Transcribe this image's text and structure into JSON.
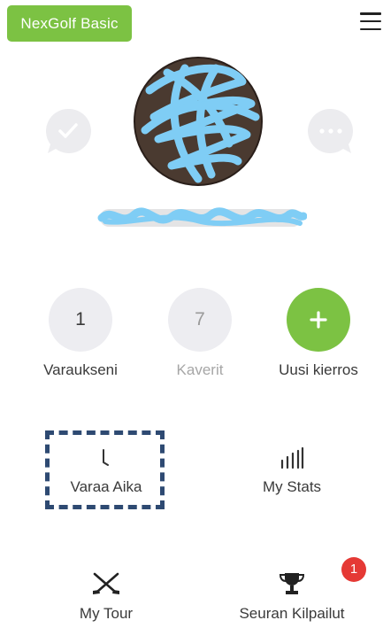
{
  "header": {
    "plan_label": "NexGolf Basic",
    "menu_icon": "hamburger-menu-icon"
  },
  "profile": {
    "left_action_icon": "check-bubble-icon",
    "right_action_icon": "more-bubble-icon"
  },
  "stats": [
    {
      "value": "1",
      "label": "Varaukseni"
    },
    {
      "value": "7",
      "label": "Kaverit"
    },
    {
      "value": "+",
      "label": "Uusi kierros"
    }
  ],
  "tiles": [
    {
      "label": "Varaa Aika",
      "icon": "clock-icon"
    },
    {
      "label": "My Stats",
      "icon": "bar-chart-icon"
    },
    {
      "label": "My Tour",
      "icon": "crossed-golf-clubs-icon"
    },
    {
      "label": "Seuran Kilpailut",
      "icon": "trophy-icon",
      "badge": "1"
    }
  ],
  "colors": {
    "accent_green": "#7cc243",
    "circle_gray": "#ededf1",
    "badge_red": "#e53935",
    "highlight_dash": "#2e4a72",
    "redaction_blue": "#7fcdf5"
  }
}
